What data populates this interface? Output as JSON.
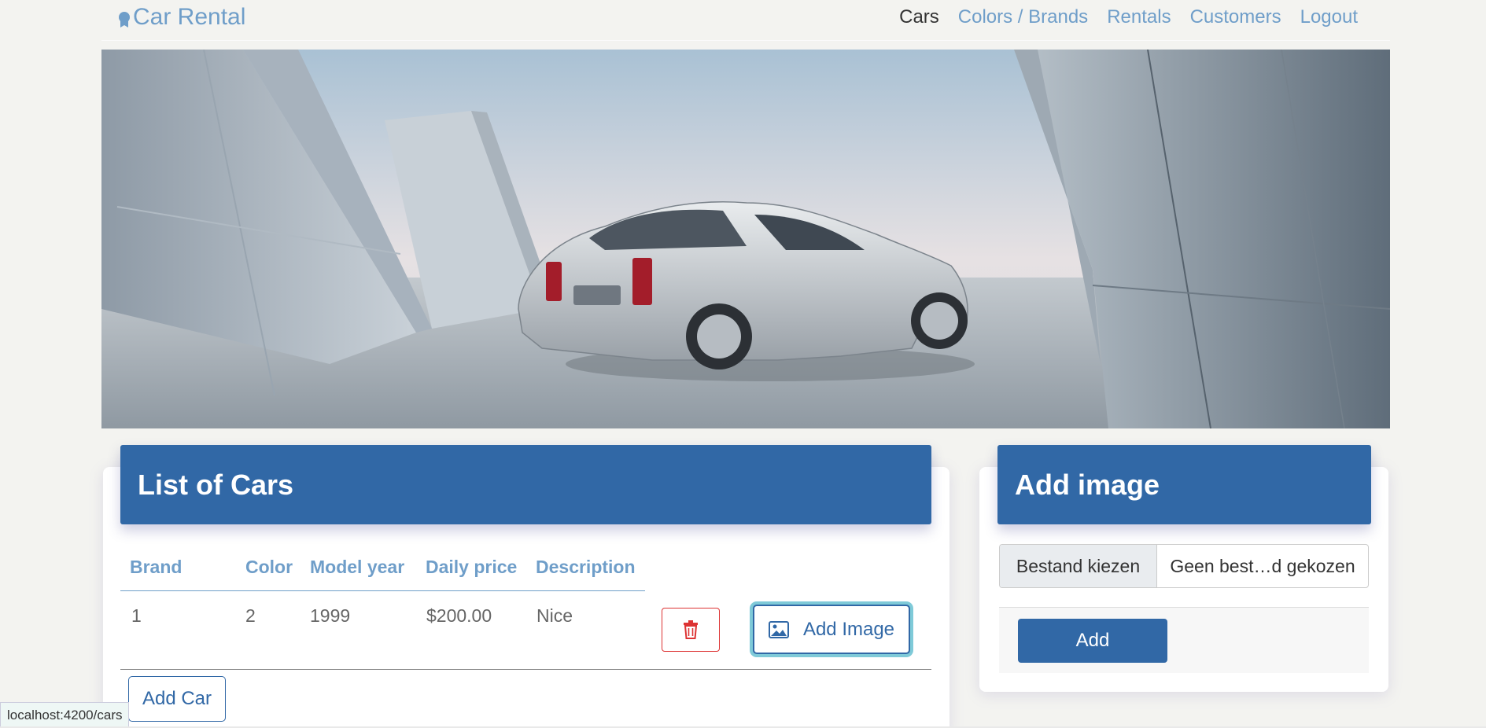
{
  "nav": {
    "brand": "Car Rental",
    "links": [
      "Cars",
      "Colors / Brands",
      "Rentals",
      "Customers",
      "Logout"
    ],
    "active": "Cars"
  },
  "cars_card": {
    "title": "List of Cars",
    "columns": [
      "Brand",
      "Color",
      "Model year",
      "Daily price",
      "Description"
    ],
    "rows": [
      {
        "brand": "1",
        "color": "2",
        "model_year": "1999",
        "daily_price": "$200.00",
        "description": "Nice"
      }
    ],
    "add_image_label": "Add Image",
    "add_car_label": "Add Car"
  },
  "image_card": {
    "title": "Add image",
    "file_button": "Bestand kiezen",
    "file_status": "Geen best…d gekozen",
    "add_label": "Add"
  },
  "status_url": "localhost:4200/cars",
  "colors": {
    "primary": "#3168a6",
    "link": "#6f9ec9",
    "danger": "#dd3333",
    "focus_ring": "#7fcad8"
  }
}
